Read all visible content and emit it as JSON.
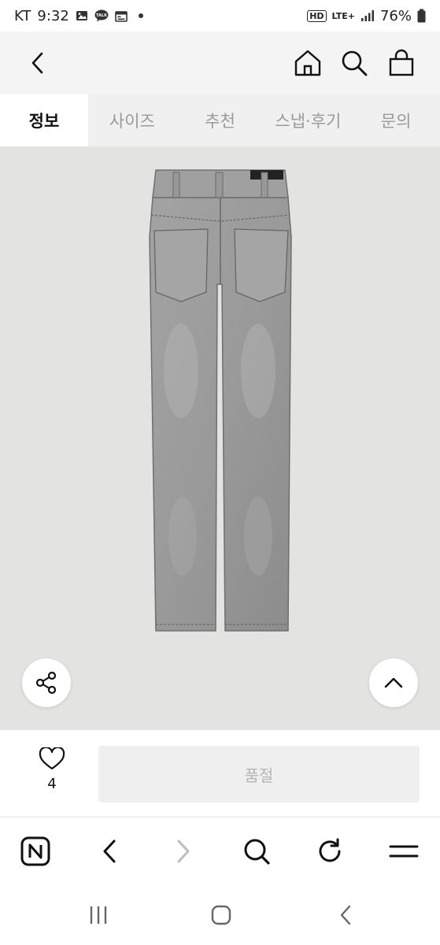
{
  "status_bar": {
    "carrier": "KT",
    "time": "9:32",
    "hd_label": "HD",
    "network": "LTE+",
    "battery": "76%",
    "notification_icons": [
      "image-icon",
      "kakaotalk-icon",
      "calendar-icon"
    ]
  },
  "header": {
    "icons": [
      "back-arrow-icon",
      "home-icon",
      "search-icon",
      "shopping-bag-icon"
    ]
  },
  "tabs": [
    {
      "label": "정보",
      "active": true
    },
    {
      "label": "사이즈",
      "active": false
    },
    {
      "label": "추천",
      "active": false
    },
    {
      "label": "스냅·후기",
      "active": false
    },
    {
      "label": "문의",
      "active": false
    }
  ],
  "product": {
    "image_icon": "grey-jeans-back-view",
    "background_color": "#e3e3e1"
  },
  "purchase": {
    "like_count": "4",
    "soldout_label": "품절"
  },
  "browser_toolbar": {
    "icons": [
      "naver-icon",
      "back-icon",
      "forward-icon",
      "search-icon",
      "refresh-icon",
      "menu-icon"
    ]
  },
  "system_nav": {
    "icons": [
      "recents-icon",
      "home-icon",
      "back-icon"
    ]
  }
}
